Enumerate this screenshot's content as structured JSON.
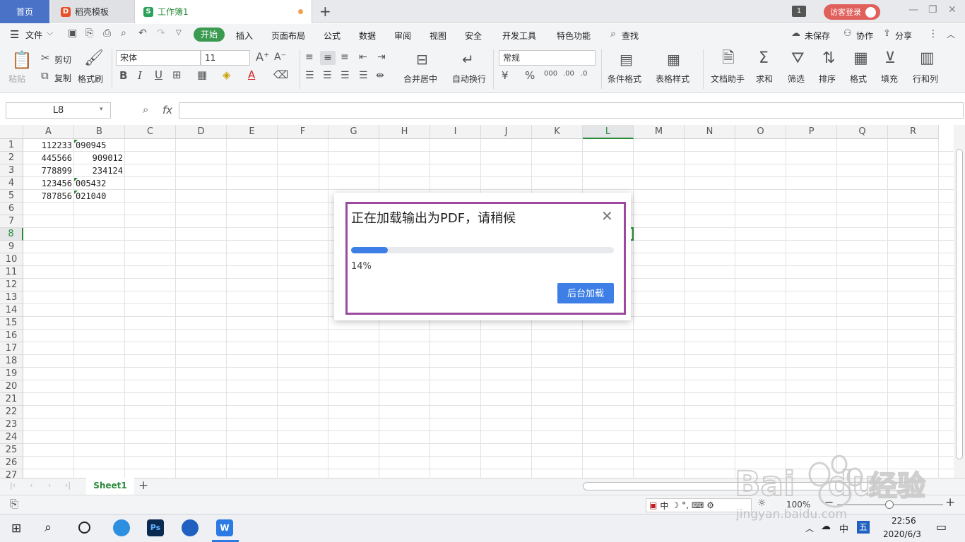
{
  "titlebar": {
    "tabs": [
      {
        "label": "首页"
      },
      {
        "label": "稻壳模板"
      },
      {
        "label": "工作簿1"
      }
    ],
    "window_badge": "1",
    "login_label": "访客登录"
  },
  "menu": {
    "file": "文件",
    "items": [
      "开始",
      "插入",
      "页面布局",
      "公式",
      "数据",
      "审阅",
      "视图",
      "安全",
      "开发工具",
      "特色功能"
    ],
    "search": "查找",
    "unsaved": "未保存",
    "collab": "协作",
    "share": "分享"
  },
  "ribbon": {
    "paste": "粘贴",
    "cut": "剪切",
    "copy": "复制",
    "format_painter": "格式刷",
    "font_name": "宋体",
    "font_size": "11",
    "merge_center": "合并居中",
    "wrap": "自动换行",
    "number_format": "常规",
    "cond_format": "条件格式",
    "table_style": "表格样式",
    "doc_helper": "文档助手",
    "sum": "求和",
    "filter": "筛选",
    "sort": "排序",
    "format": "格式",
    "fill": "填充",
    "row_col": "行和列"
  },
  "formula_bar": {
    "name_box": "L8",
    "fx": "fx",
    "formula": ""
  },
  "grid": {
    "columns": [
      "A",
      "B",
      "C",
      "D",
      "E",
      "F",
      "G",
      "H",
      "I",
      "J",
      "K",
      "L",
      "M",
      "N",
      "O",
      "P",
      "Q",
      "R"
    ],
    "selected_column": "L",
    "rows": [
      "1",
      "2",
      "3",
      "4",
      "5",
      "6",
      "7",
      "8",
      "9",
      "10",
      "11",
      "12",
      "13",
      "14",
      "15",
      "16",
      "17",
      "18",
      "19",
      "20",
      "21",
      "22",
      "23",
      "24",
      "25",
      "26",
      "27"
    ],
    "selected_row": "8",
    "cells": [
      {
        "a": "112233",
        "b": "090945",
        "b_text": true
      },
      {
        "a": "445566",
        "b": "909012",
        "b_text": false
      },
      {
        "a": "778899",
        "b": "234124",
        "b_text": false
      },
      {
        "a": "123456",
        "b": "005432",
        "b_text": true
      },
      {
        "a": "787856",
        "b": "021040",
        "b_text": true
      }
    ]
  },
  "sheets": {
    "active": "Sheet1"
  },
  "status": {
    "zoom": "100%"
  },
  "dialog": {
    "title": "正在加载输出为PDF，请稍候",
    "progress_text": "14%",
    "progress_value": 0.14,
    "background_button": "后台加载"
  },
  "taskbar": {
    "ime_mode": "中",
    "ime_name": "五",
    "time": "22:56",
    "date": "2020/6/3"
  },
  "watermark": {
    "brand": "Baidu经验",
    "url": "jingyan.baidu.com"
  },
  "colors": {
    "accent_green": "#3a9a50",
    "accent_blue": "#3d7fe6",
    "home_tab": "#4a73c8",
    "highlight_frame": "#9b4aa0"
  }
}
